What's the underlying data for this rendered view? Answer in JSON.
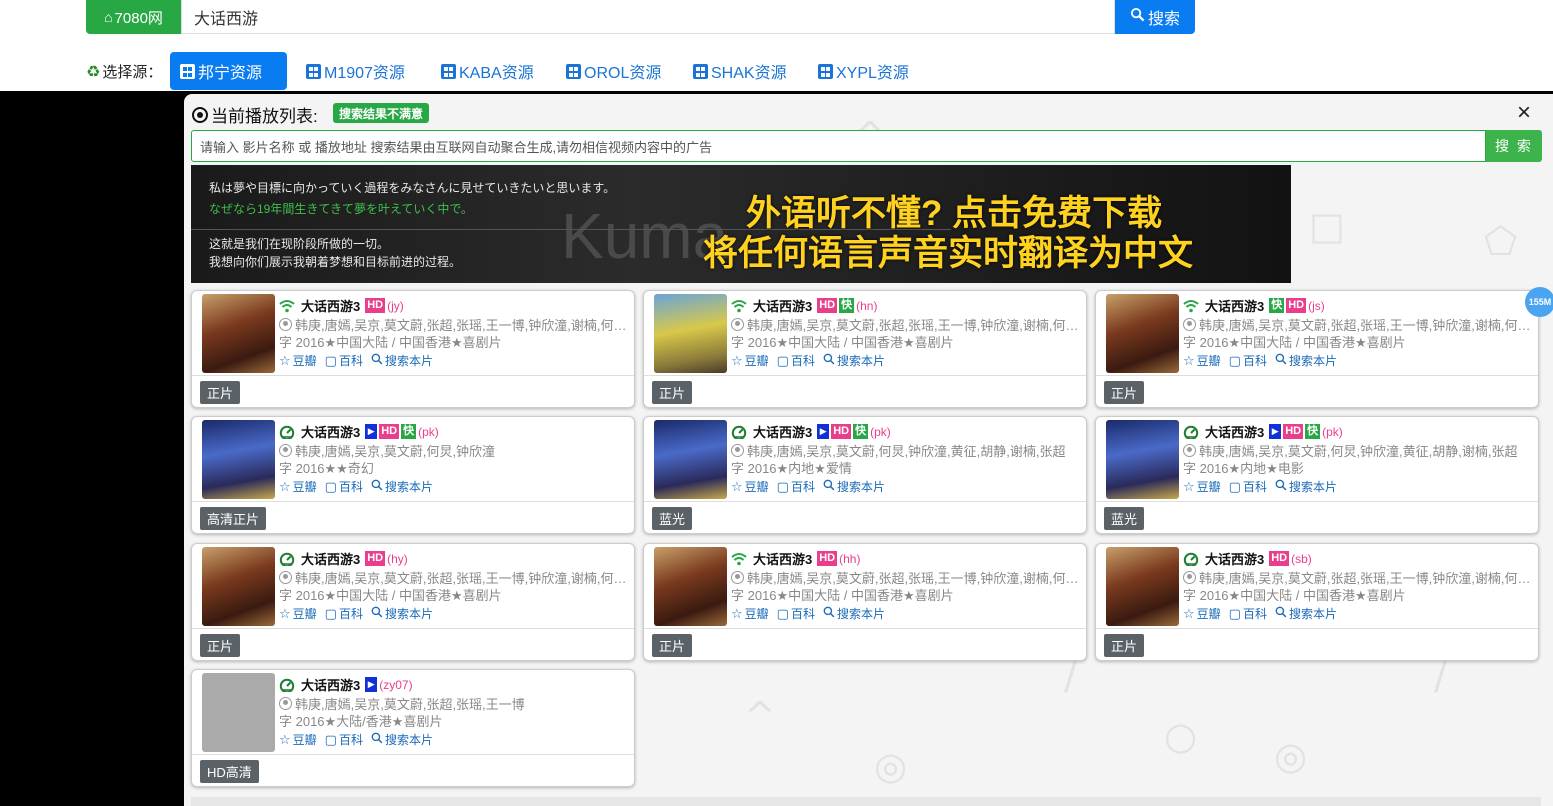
{
  "site": {
    "logo_label": "7080网"
  },
  "search": {
    "value": "大话西游",
    "button_label": "搜索"
  },
  "sources": {
    "label": "选择源：",
    "items": [
      "邦宁资源",
      "M1907资源",
      "KABA资源",
      "OROL资源",
      "SHAK资源",
      "XYPL资源"
    ],
    "active_index": 0
  },
  "panel": {
    "title": "当前播放列表:",
    "badge": "搜索结果不满意",
    "close": "×",
    "search_placeholder": "请输入 影片名称 或 播放地址 搜索结果由互联网自动聚合生成,请勿相信视频内容中的广告",
    "search_button": "搜 索"
  },
  "ad": {
    "jp_line": "私は夢や目標に向かっていく過程をみなさんに見せていきたいと思います。",
    "jp_line2": "なぜなら19年間生きてきて夢を叶えていく中で。",
    "zh_line1": "这就是我们在现阶段所做的一切。",
    "zh_line2": "我想向你们展示我朝着梦想和目标前进的过程。",
    "bg_word": "Kuma",
    "headline1": "外语听不懂? 点击免费下载",
    "headline2": "将任何语言声音实时翻译为中文"
  },
  "side_badge": "155M",
  "cards": [
    {
      "title": "大话西游3",
      "tags": [
        "HD"
      ],
      "code": "(jy)",
      "actors": "韩庚,唐嫣,吴京,莫文蔚,张超,张瑶,王一博,钟欣潼,谢楠,何炅...",
      "meta": "字 2016★中国大陆 / 中国香港★喜剧片",
      "douban": "豆瓣",
      "baike": "百科",
      "search": "搜索本片",
      "quality": "正片",
      "signal": "wifi",
      "poster": "p-a"
    },
    {
      "title": "大话西游3",
      "tags": [
        "HD",
        "快"
      ],
      "code": "(hn)",
      "actors": "韩庚,唐嫣,吴京,莫文蔚,张超,张瑶,王一博,钟欣潼,谢楠,何炅...",
      "meta": "字 2016★中国大陆 / 中国香港★喜剧片",
      "douban": "豆瓣",
      "baike": "百科",
      "search": "搜索本片",
      "quality": "正片",
      "signal": "wifi",
      "poster": "p-b"
    },
    {
      "title": "大话西游3",
      "tags": [
        "快",
        "HD"
      ],
      "code": "(js)",
      "actors": "韩庚,唐嫣,吴京,莫文蔚,张超,张瑶,王一博,钟欣潼,谢楠,何炅...",
      "meta": "字 2016★中国大陆 / 中国香港★喜剧片",
      "douban": "豆瓣",
      "baike": "百科",
      "search": "搜索本片",
      "quality": "正片",
      "signal": "wifi",
      "poster": "p-a"
    },
    {
      "title": "大话西游3",
      "tags": [
        "▶",
        "HD",
        "快"
      ],
      "code": "(pk)",
      "actors": "韩庚,唐嫣,吴京,莫文蔚,何炅,钟欣潼",
      "meta": "字 2016★★奇幻",
      "douban": "豆瓣",
      "baike": "百科",
      "search": "搜索本片",
      "quality": "高清正片",
      "signal": "gauge",
      "poster": "p-c"
    },
    {
      "title": "大话西游3",
      "tags": [
        "▶",
        "HD",
        "快"
      ],
      "code": "(pk)",
      "actors": "韩庚,唐嫣,吴京,莫文蔚,何炅,钟欣潼,黄征,胡静,谢楠,张超",
      "meta": "字 2016★内地★爱情",
      "douban": "豆瓣",
      "baike": "百科",
      "search": "搜索本片",
      "quality": "蓝光",
      "signal": "gauge",
      "poster": "p-c"
    },
    {
      "title": "大话西游3",
      "tags": [
        "▶",
        "HD",
        "快"
      ],
      "code": "(pk)",
      "actors": "韩庚,唐嫣,吴京,莫文蔚,何炅,钟欣潼,黄征,胡静,谢楠,张超",
      "meta": "字 2016★内地★电影",
      "douban": "豆瓣",
      "baike": "百科",
      "search": "搜索本片",
      "quality": "蓝光",
      "signal": "gauge",
      "poster": "p-c"
    },
    {
      "title": "大话西游3",
      "tags": [
        "HD"
      ],
      "code": "(hy)",
      "actors": "韩庚,唐嫣,吴京,莫文蔚,张超,张瑶,王一博,钟欣潼,谢楠,何炅...",
      "meta": "字 2016★中国大陆 / 中国香港★喜剧片",
      "douban": "豆瓣",
      "baike": "百科",
      "search": "搜索本片",
      "quality": "正片",
      "signal": "gauge",
      "poster": "p-a"
    },
    {
      "title": "大话西游3",
      "tags": [
        "HD"
      ],
      "code": "(hh)",
      "actors": "韩庚,唐嫣,吴京,莫文蔚,张超,张瑶,王一博,钟欣潼,谢楠,何炅...",
      "meta": "字 2016★中国大陆 / 中国香港★喜剧片",
      "douban": "豆瓣",
      "baike": "百科",
      "search": "搜索本片",
      "quality": "正片",
      "signal": "wifi",
      "poster": "p-a"
    },
    {
      "title": "大话西游3",
      "tags": [
        "HD"
      ],
      "code": "(sb)",
      "actors": "韩庚,唐嫣,吴京,莫文蔚,张超,张瑶,王一博,钟欣潼,谢楠,何炅...",
      "meta": "字 2016★中国大陆 / 中国香港★喜剧片",
      "douban": "豆瓣",
      "baike": "百科",
      "search": "搜索本片",
      "quality": "正片",
      "signal": "gauge",
      "poster": "p-a"
    },
    {
      "title": "大话西游3",
      "tags": [
        "▶"
      ],
      "code": "(zy07)",
      "actors": "韩庚,唐嫣,吴京,莫文蔚,张超,张瑶,王一博",
      "meta": "字 2016★大陆/香港★喜剧片",
      "douban": "豆瓣",
      "baike": "百科",
      "search": "搜索本片",
      "quality": "HD高清",
      "signal": "gauge",
      "poster": "p-d"
    }
  ],
  "colors": {
    "green": "#28a745",
    "blue": "#0a7cf2",
    "hd": "#e83e8c",
    "play": "#1030d8"
  }
}
